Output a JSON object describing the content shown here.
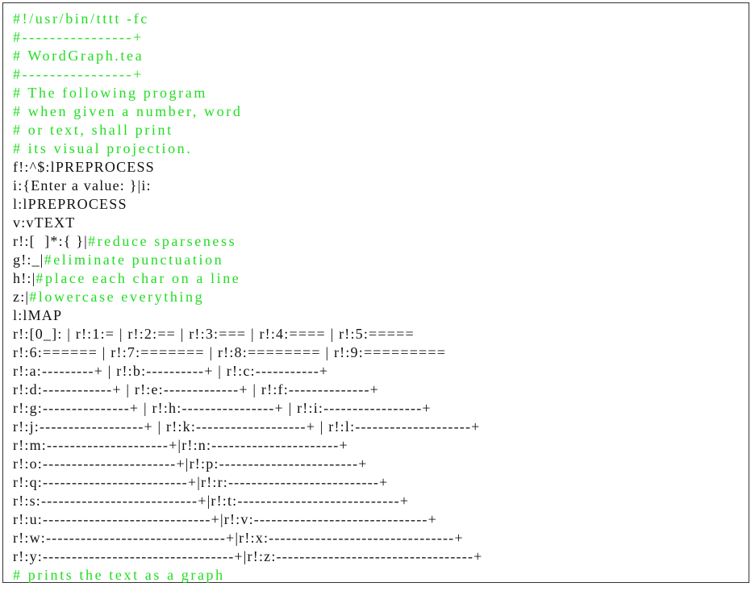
{
  "colors": {
    "comment": "#22dd22",
    "code": "#111111",
    "border": "#333333"
  },
  "lines": [
    [
      {
        "t": "#!/usr/bin/tttt -fc",
        "c": "comment"
      }
    ],
    [
      {
        "t": "#----------------+",
        "c": "comment"
      }
    ],
    [
      {
        "t": "# WordGraph.tea",
        "c": "comment"
      }
    ],
    [
      {
        "t": "#----------------+",
        "c": "comment"
      }
    ],
    [
      {
        "t": "# The following program",
        "c": "comment"
      }
    ],
    [
      {
        "t": "# when given a number, word",
        "c": "comment"
      }
    ],
    [
      {
        "t": "# or text, shall print",
        "c": "comment"
      }
    ],
    [
      {
        "t": "# its visual projection.",
        "c": "comment"
      }
    ],
    [
      {
        "t": "f!:^$:lPREPROCESS",
        "c": "code"
      }
    ],
    [
      {
        "t": "i:{Enter a value: }|i:",
        "c": "code"
      }
    ],
    [
      {
        "t": "l:lPREPROCESS",
        "c": "code"
      }
    ],
    [
      {
        "t": "v:vTEXT",
        "c": "code"
      }
    ],
    [
      {
        "t": "r!:[  ]*:{ }|",
        "c": "code"
      },
      {
        "t": "#reduce sparseness",
        "c": "comment"
      }
    ],
    [
      {
        "t": "g!:_|",
        "c": "code"
      },
      {
        "t": "#eliminate punctuation",
        "c": "comment"
      }
    ],
    [
      {
        "t": "h!:|",
        "c": "code"
      },
      {
        "t": "#place each char on a line",
        "c": "comment"
      }
    ],
    [
      {
        "t": "z:|",
        "c": "code"
      },
      {
        "t": "#lowercase everything",
        "c": "comment"
      }
    ],
    [
      {
        "t": "l:lMAP",
        "c": "code"
      }
    ],
    [
      {
        "t": "r!:[0_]: | r!:1:= | r!:2:== | r!:3:=== | r!:4:==== | r!:5:=====",
        "c": "code"
      }
    ],
    [
      {
        "t": "r!:6:====== | r!:7:======= | r!:8:======== | r!:9:=========",
        "c": "code"
      }
    ],
    [
      {
        "t": "r!:a:---------+ | r!:b:----------+ | r!:c:-----------+",
        "c": "code"
      }
    ],
    [
      {
        "t": "r!:d:------------+ | r!:e:-------------+ | r!:f:--------------+",
        "c": "code"
      }
    ],
    [
      {
        "t": "r!:g:---------------+ | r!:h:----------------+ | r!:i:-----------------+",
        "c": "code"
      }
    ],
    [
      {
        "t": "r!:j:------------------+ | r!:k:-------------------+ | r!:l:--------------------+",
        "c": "code"
      }
    ],
    [
      {
        "t": "r!:m:---------------------+|r!:n:----------------------+",
        "c": "code"
      }
    ],
    [
      {
        "t": "r!:o:-----------------------+|r!:p:------------------------+",
        "c": "code"
      }
    ],
    [
      {
        "t": "r!:q:-------------------------+|r!:r:--------------------------+",
        "c": "code"
      }
    ],
    [
      {
        "t": "r!:s:---------------------------+|r!:t:----------------------------+",
        "c": "code"
      }
    ],
    [
      {
        "t": "r!:u:-----------------------------+|r!:v:------------------------------+",
        "c": "code"
      }
    ],
    [
      {
        "t": "r!:w:-------------------------------+|r!:x:--------------------------------+",
        "c": "code"
      }
    ],
    [
      {
        "t": "r!:y:---------------------------------+|r!:z:----------------------------------+",
        "c": "code"
      }
    ],
    [
      {
        "t": "# prints the text as a graph",
        "c": "comment"
      }
    ]
  ]
}
